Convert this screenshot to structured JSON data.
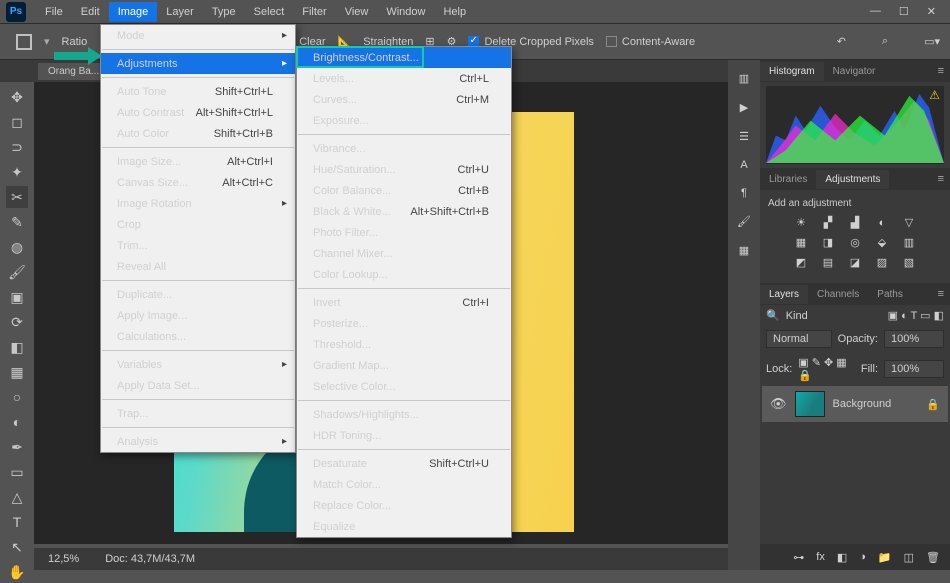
{
  "app": {
    "logo": "Ps"
  },
  "menubar": {
    "items": [
      "File",
      "Edit",
      "Image",
      "Layer",
      "Type",
      "Select",
      "Filter",
      "View",
      "Window",
      "Help"
    ],
    "open_index": 2
  },
  "win": {
    "min": "—",
    "max": "☐",
    "close": "✕"
  },
  "optbar": {
    "ratio": "Ratio",
    "clear": "Clear",
    "straighten": "Straighten",
    "delete_cropped": "Delete Cropped Pixels",
    "content_aware": "Content-Aware"
  },
  "tab": {
    "name": "Orang Ba..."
  },
  "imgmenu": {
    "mode": "Mode",
    "adjustments": "Adjustments",
    "auto_tone": {
      "l": "Auto Tone",
      "s": "Shift+Ctrl+L"
    },
    "auto_contrast": {
      "l": "Auto Contrast",
      "s": "Alt+Shift+Ctrl+L"
    },
    "auto_color": {
      "l": "Auto Color",
      "s": "Shift+Ctrl+B"
    },
    "image_size": {
      "l": "Image Size...",
      "s": "Alt+Ctrl+I"
    },
    "canvas_size": {
      "l": "Canvas Size...",
      "s": "Alt+Ctrl+C"
    },
    "image_rotation": "Image Rotation",
    "crop": "Crop",
    "trim": "Trim...",
    "reveal": "Reveal All",
    "duplicate": "Duplicate...",
    "apply_image": "Apply Image...",
    "calculations": "Calculations...",
    "variables": "Variables",
    "apply_data": "Apply Data Set...",
    "trap": "Trap...",
    "analysis": "Analysis"
  },
  "adjmenu": {
    "brightness": "Brightness/Contrast...",
    "levels": {
      "l": "Levels...",
      "s": "Ctrl+L"
    },
    "curves": {
      "l": "Curves...",
      "s": "Ctrl+M"
    },
    "exposure": "Exposure...",
    "vibrance": "Vibrance...",
    "hue": {
      "l": "Hue/Saturation...",
      "s": "Ctrl+U"
    },
    "color_balance": {
      "l": "Color Balance...",
      "s": "Ctrl+B"
    },
    "bw": {
      "l": "Black & White...",
      "s": "Alt+Shift+Ctrl+B"
    },
    "photo_filter": "Photo Filter...",
    "channel_mixer": "Channel Mixer...",
    "color_lookup": "Color Lookup...",
    "invert": {
      "l": "Invert",
      "s": "Ctrl+I"
    },
    "posterize": "Posterize...",
    "threshold": "Threshold...",
    "gradient_map": "Gradient Map...",
    "selective": "Selective Color...",
    "shadows": "Shadows/Highlights...",
    "hdr": "HDR Toning...",
    "desaturate": {
      "l": "Desaturate",
      "s": "Shift+Ctrl+U"
    },
    "match": "Match Color...",
    "replace": "Replace Color...",
    "equalize": "Equalize"
  },
  "panels": {
    "histogram": "Histogram",
    "navigator": "Navigator",
    "libraries": "Libraries",
    "adjustments": "Adjustments",
    "add_adj": "Add an adjustment",
    "layers": "Layers",
    "channels": "Channels",
    "paths": "Paths",
    "kind": "Kind",
    "blend": "Normal",
    "opacity_l": "Opacity:",
    "opacity_v": "100%",
    "lock": "Lock:",
    "fill_l": "Fill:",
    "fill_v": "100%",
    "layer_name": "Background"
  },
  "status": {
    "zoom": "12,5%",
    "doc": "Doc: 43,7M/43,7M"
  },
  "icons": {
    "move": "✥",
    "marquee": "◻",
    "lasso": "⊃",
    "wand": "✦",
    "crop": "✂",
    "eyedrop": "✎",
    "heal": "◍",
    "brush": "🖌",
    "stamp": "▣",
    "history": "⟳",
    "eraser": "◧",
    "gradient": "▦",
    "blur": "○",
    "dodge": "◐",
    "pen": "✒",
    "rect": "▭",
    "triangle": "△",
    "type": "T",
    "path": "↖",
    "hand": "✋",
    "search": "⌕",
    "undo": "↶",
    "eye": "👁",
    "lock": "🔒",
    "trash": "🗑",
    "folder": "📁",
    "mask": "◧",
    "fx": "fx",
    "brightness": "☀",
    "levels": "▞",
    "curves": "▟",
    "exposure": "◐",
    "vibrance": "▽",
    "hue": "▦",
    "bw": "◨",
    "photo": "◎",
    "mixer": "⬙",
    "lookup": "▥",
    "invert": "◩",
    "poster": "▤",
    "thresh": "◪",
    "sel": "▨",
    "grad": "▧"
  }
}
